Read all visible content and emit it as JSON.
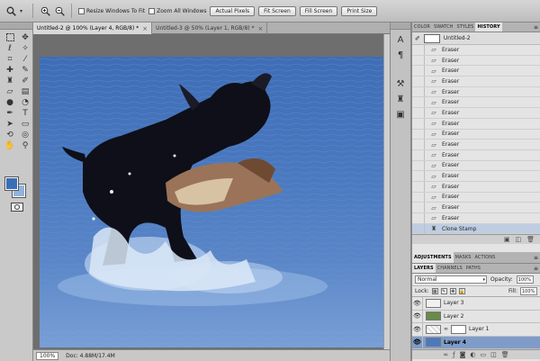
{
  "options_bar": {
    "tool_icon": "zoom-tool-icon",
    "checkbox_resize": "Resize Windows To Fit",
    "checkbox_zoom_all": "Zoom All Windows",
    "buttons": [
      "Actual Pixels",
      "Fit Screen",
      "Fill Screen",
      "Print Size"
    ]
  },
  "doc_tabs": [
    {
      "label": "Untitled-2 @ 100% (Layer 4, RGB/8) *",
      "close": "×",
      "active": true
    },
    {
      "label": "Untitled-3 @ 50% (Layer 1, RGB/8) *",
      "close": "×",
      "active": false
    }
  ],
  "status_bar": {
    "zoom": "100%",
    "doc": "Doc: 4.88M/17.4M"
  },
  "colors": {
    "foreground": "#3a6fb5",
    "background": "#8fb4e0",
    "selection": "#7f9cc8"
  },
  "history_panel": {
    "tabs": [
      "COLOR",
      "SWATCH",
      "STYLES",
      "HISTORY"
    ],
    "active_tab": "HISTORY",
    "snapshot": "Untitled-2",
    "items": [
      "Eraser",
      "Eraser",
      "Eraser",
      "Eraser",
      "Eraser",
      "Eraser",
      "Eraser",
      "Eraser",
      "Eraser",
      "Eraser",
      "Eraser",
      "Eraser",
      "Eraser",
      "Eraser",
      "Eraser",
      "Eraser",
      "Eraser",
      "Clone Stamp"
    ]
  },
  "adjust_panel": {
    "tabs": [
      "ADJUSTMENTS",
      "MASKS",
      "ACTIONS"
    ]
  },
  "layers_panel": {
    "tabs": [
      "LAYERS",
      "CHANNELS",
      "PATHS"
    ],
    "blend_mode": "Normal",
    "opacity_label": "Opacity:",
    "opacity_value": "100%",
    "lock_label": "Lock:",
    "fill_label": "Fill:",
    "fill_value": "100%",
    "layers": [
      {
        "name": "Layer 3",
        "selected": false,
        "mask": false
      },
      {
        "name": "Layer 2",
        "selected": false,
        "mask": false
      },
      {
        "name": "Layer 1",
        "selected": false,
        "mask": true
      },
      {
        "name": "Layer 4",
        "selected": true,
        "mask": false
      }
    ]
  }
}
